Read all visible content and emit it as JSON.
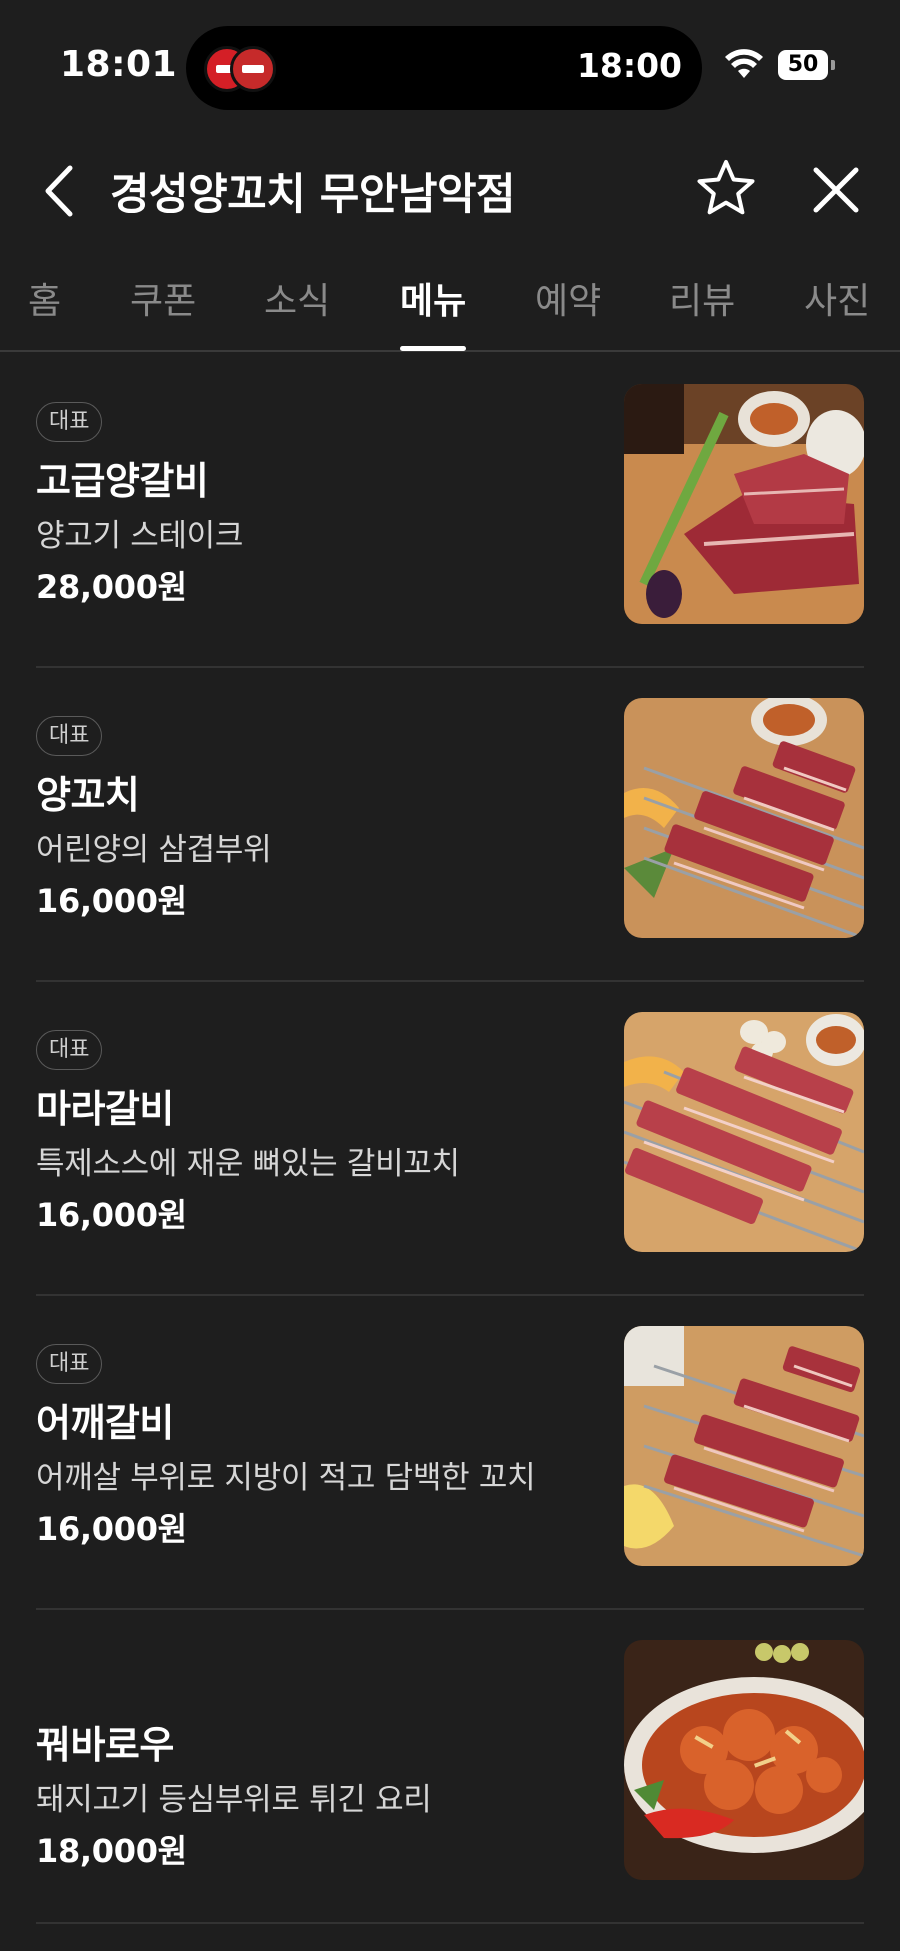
{
  "status_bar": {
    "time": "18:01",
    "island_time": "18:00",
    "battery": "50"
  },
  "header": {
    "title": "경성양꼬치 무안남악점"
  },
  "tabs": [
    {
      "label": "홈"
    },
    {
      "label": "쿠폰"
    },
    {
      "label": "소식"
    },
    {
      "label": "메뉴"
    },
    {
      "label": "예약"
    },
    {
      "label": "리뷰"
    },
    {
      "label": "사진"
    }
  ],
  "active_tab": "메뉴",
  "menu_items": [
    {
      "badge": "대표",
      "name": "고급양갈비",
      "description": "양고기 스테이크",
      "price": "28,000원"
    },
    {
      "badge": "대표",
      "name": "양꼬치",
      "description": "어린양의 삼겹부위",
      "price": "16,000원"
    },
    {
      "badge": "대표",
      "name": "마라갈비",
      "description": "특제소스에 재운 뼈있는 갈비꼬치",
      "price": "16,000원"
    },
    {
      "badge": "대표",
      "name": "어깨갈비",
      "description": "어깨살 부위로 지방이 적고 담백한 꼬치",
      "price": "16,000원"
    },
    {
      "badge": "",
      "name": "꿔바로우",
      "description": "돼지고기 등심부위로 튀긴 요리",
      "price": "18,000원"
    }
  ],
  "colors": {
    "background": "#1e1e1e",
    "text_primary": "#ffffff",
    "text_inactive": "#8a8a8a",
    "divider": "#333333"
  }
}
